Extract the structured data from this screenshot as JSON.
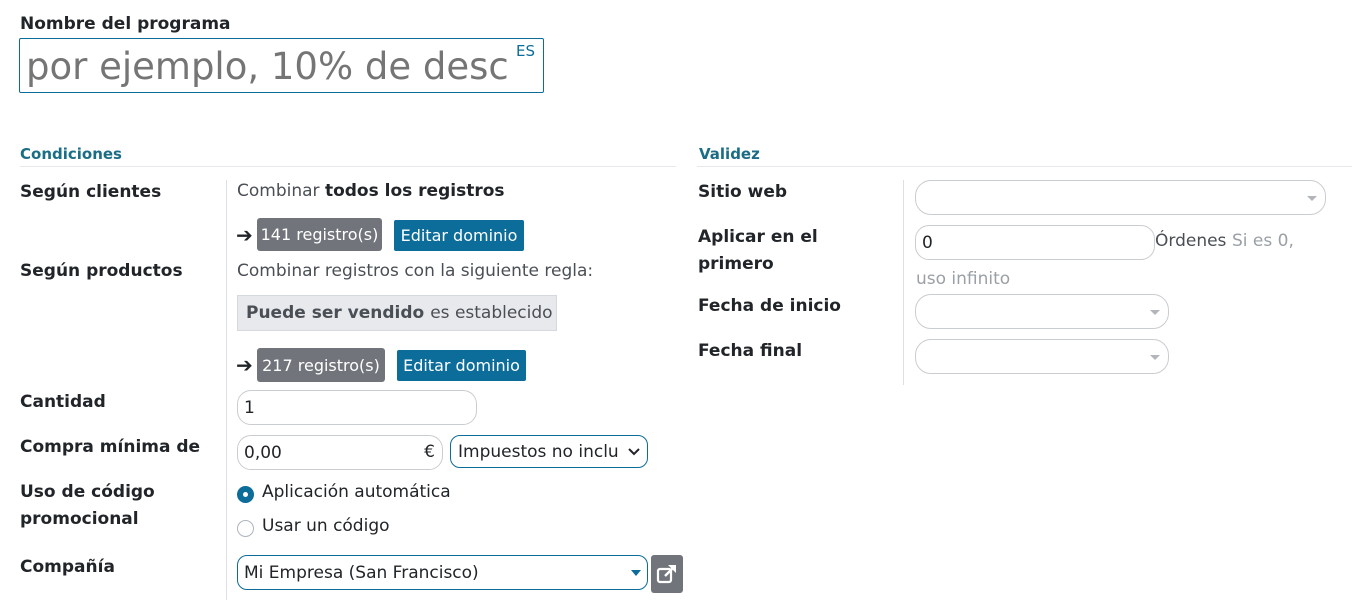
{
  "program_name": {
    "label": "Nombre del programa",
    "placeholder": "por ejemplo, 10% de desc",
    "lang_badge": "ES"
  },
  "conditions": {
    "title": "Condiciones",
    "customers": {
      "label": "Según clientes",
      "combine_prefix": "Combinar",
      "combine_bold": "todos los registros",
      "records_button": "141 registro(s)",
      "edit_domain": "Editar dominio"
    },
    "products": {
      "label": "Según productos",
      "combine_text": "Combinar registros con la siguiente regla:",
      "rule_bold": "Puede ser vendido",
      "rule_rest": "es establecido",
      "records_button": "217 registro(s)",
      "edit_domain": "Editar dominio"
    },
    "quantity": {
      "label": "Cantidad",
      "value": "1"
    },
    "min_purchase": {
      "label": "Compra mínima de",
      "value": "0,00",
      "currency": "€",
      "tax_option": "Impuestos no inclu"
    },
    "promo_code_usage": {
      "label_line1": "Uso de código",
      "label_line2": "promocional",
      "option_auto": "Aplicación automática",
      "option_code": "Usar un código",
      "selected": "Aplicación automática"
    },
    "company": {
      "label": "Compañía",
      "value": "Mi Empresa (San Francisco)"
    }
  },
  "validity": {
    "title": "Validez",
    "website": {
      "label": "Sitio web",
      "value": ""
    },
    "apply_first": {
      "label_line1": "Aplicar en el",
      "label_line2": "primero",
      "value": "0",
      "unit": "Órdenes",
      "hint_part1": "Si es 0,",
      "hint_part2": "uso infinito"
    },
    "start_date": {
      "label": "Fecha de inicio",
      "value": ""
    },
    "end_date": {
      "label": "Fecha final",
      "value": ""
    }
  },
  "colors": {
    "accent": "#0c6c9a",
    "section_title": "#1b6d85",
    "records_button": "#71757b"
  },
  "icons": {
    "arrow": "arrow-right-icon",
    "external_link": "external-link-icon",
    "dropdown": "chevron-down-icon"
  }
}
